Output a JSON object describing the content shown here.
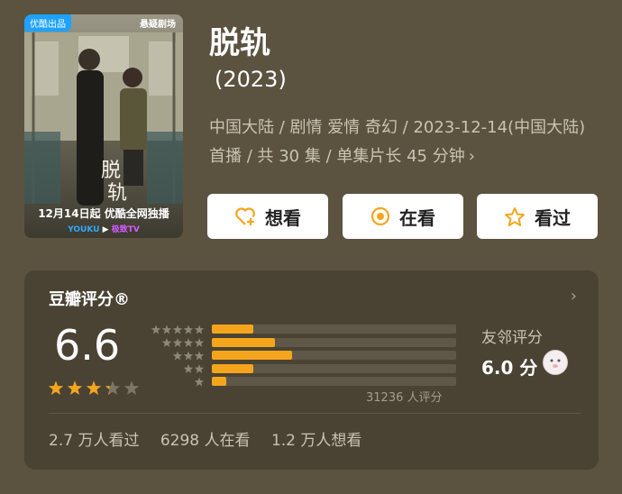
{
  "poster": {
    "tag": "优酷出品",
    "brand": "悬疑剧场",
    "release_line": "12月14日起 优酷全网独播",
    "logo_youku": "YOUKU",
    "logo_second": "极致TV"
  },
  "title": "脱轨",
  "year": "(2023)",
  "meta": "中国大陆 / 剧情 爱情 奇幻 / 2023-12-14(中国大陆) 首播 / 共 30 集 / 单集片长 45 分钟",
  "meta_chevron": "›",
  "actions": {
    "want": "想看",
    "watching": "在看",
    "watched": "看过"
  },
  "rating": {
    "panel_title": "豆瓣评分®",
    "chevron": "›",
    "score": "6.6",
    "star_fraction": 0.66,
    "distribution_fraction": [
      0.17,
      0.26,
      0.33,
      0.17,
      0.06
    ],
    "votes": "31236 人评分",
    "friend_label": "友邻评分",
    "friend_score": "6.0 分"
  },
  "stats": {
    "watched": "2.7 万人看过",
    "watching": "6298 人在看",
    "want": "1.2 万人想看"
  },
  "colors": {
    "background": "#5b5340",
    "panel": "#4a4334",
    "star": "#f5a51c",
    "bar": "#f5a51c"
  }
}
